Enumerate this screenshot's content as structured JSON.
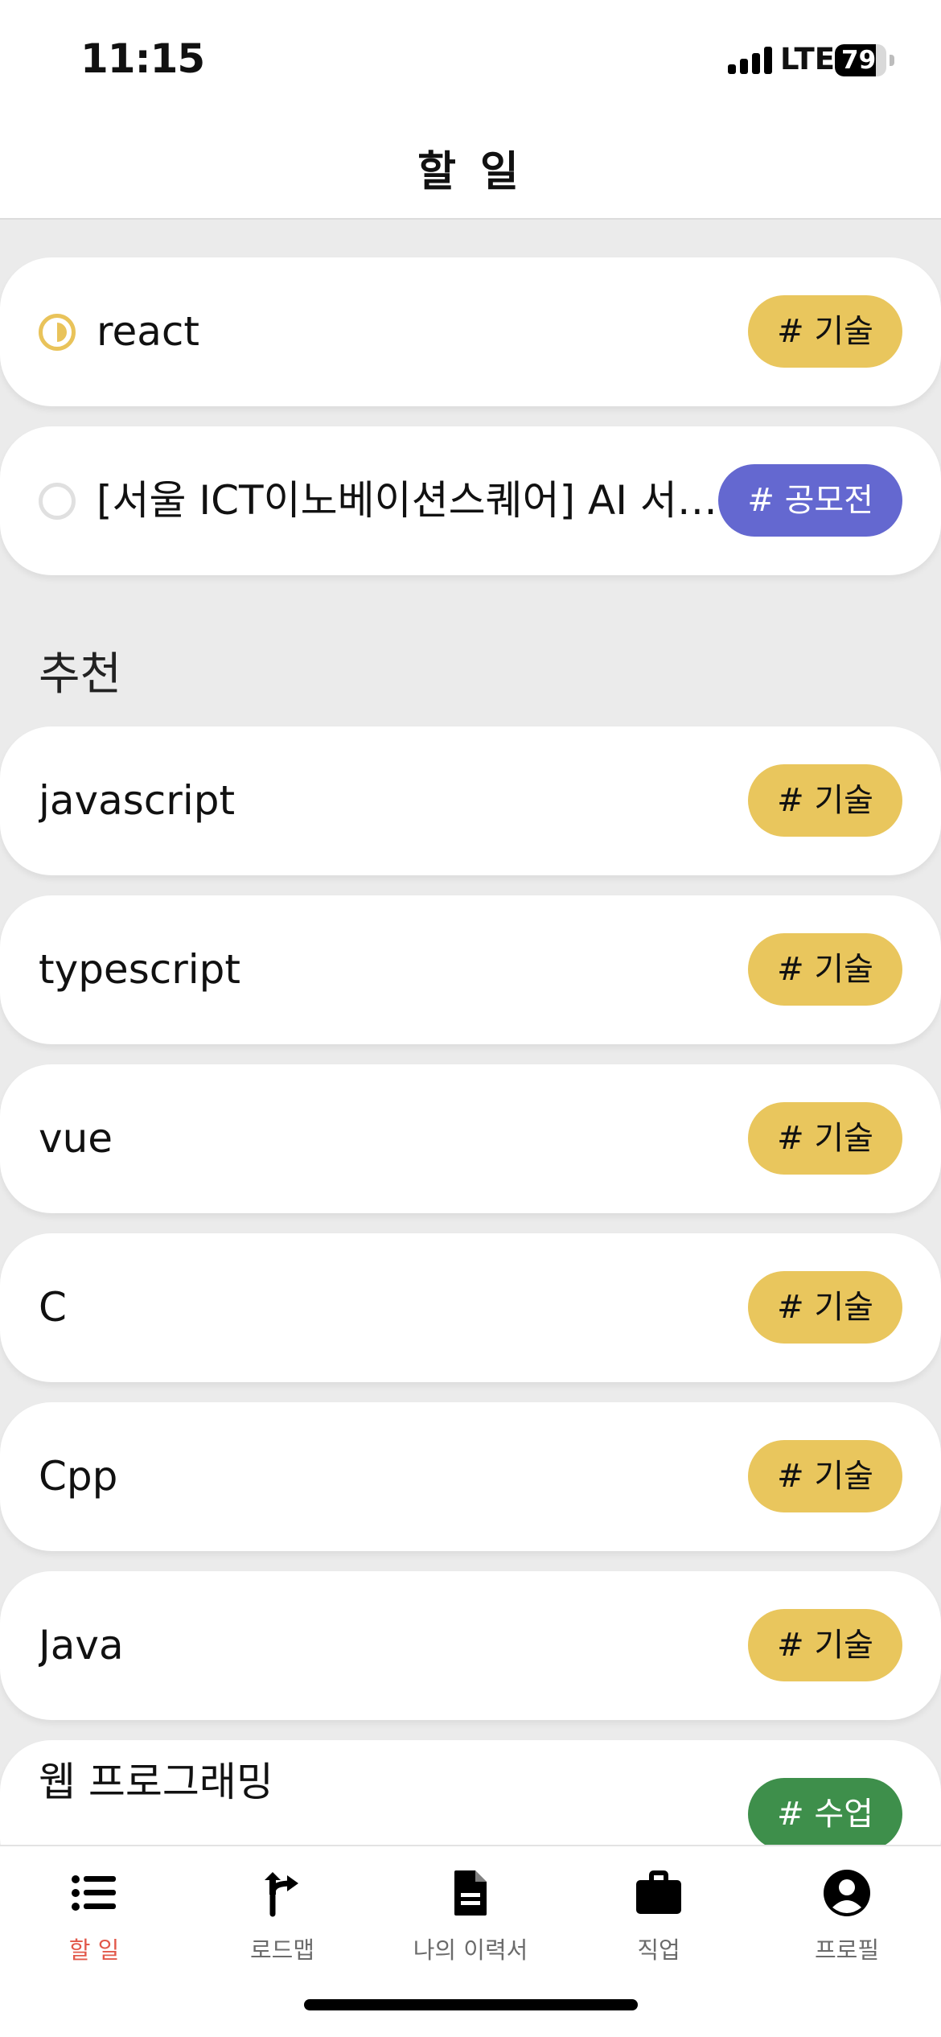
{
  "status_bar": {
    "time": "11:15",
    "network": "LTE",
    "battery": "79",
    "battery_level": 0.79
  },
  "header": {
    "title": "할 일"
  },
  "todos": [
    {
      "title": "react",
      "status": "in-progress",
      "tag": "# 기술",
      "tag_type": "tech"
    },
    {
      "title": "[서울 ICT이노베이션스퀘어] AI 서비스",
      "status": "not-started",
      "tag": "# 공모전",
      "tag_type": "contest"
    }
  ],
  "recommend": {
    "title": "추천",
    "items": [
      {
        "title": "javascript",
        "tag": "# 기술",
        "tag_type": "tech"
      },
      {
        "title": "typescript",
        "tag": "# 기술",
        "tag_type": "tech"
      },
      {
        "title": "vue",
        "tag": "# 기술",
        "tag_type": "tech"
      },
      {
        "title": "C",
        "tag": "# 기술",
        "tag_type": "tech"
      },
      {
        "title": "Cpp",
        "tag": "# 기술",
        "tag_type": "tech"
      },
      {
        "title": "Java",
        "tag": "# 기술",
        "tag_type": "tech"
      },
      {
        "title": "웹 프로그래밍",
        "tag": "# 수업",
        "tag_type": "class"
      }
    ]
  },
  "tabs": [
    {
      "label": "할 일",
      "icon": "list-icon",
      "active": true
    },
    {
      "label": "로드맵",
      "icon": "roadmap-arrow-icon",
      "active": false
    },
    {
      "label": "나의 이력서",
      "icon": "document-icon",
      "active": false
    },
    {
      "label": "직업",
      "icon": "briefcase-icon",
      "active": false
    },
    {
      "label": "프로필",
      "icon": "profile-icon",
      "active": false
    }
  ],
  "colors": {
    "tag_tech": "#e9c65d",
    "tag_contest": "#6468d0",
    "tag_class": "#3e8f4b",
    "active_tab": "#e2584a",
    "progress": "#e9c35a"
  }
}
